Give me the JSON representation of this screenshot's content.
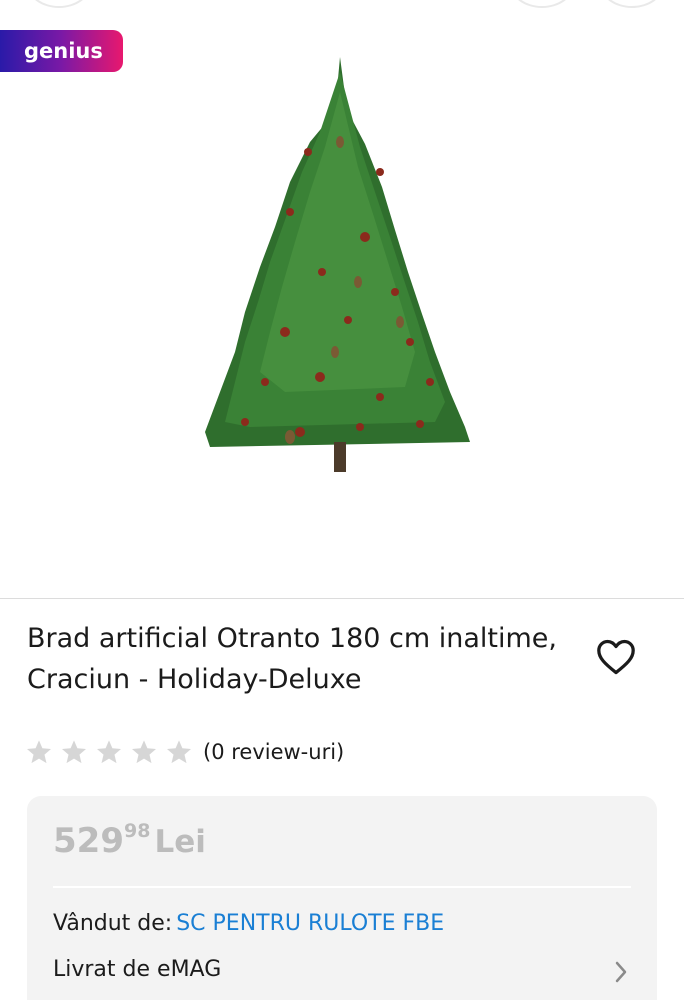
{
  "badge": {
    "label": "genius"
  },
  "product": {
    "title": "Brad artificial Otranto 180 cm inaltime, Craciun - Holiday-Deluxe",
    "image_subject": "christmas-tree"
  },
  "rating": {
    "stars_filled": 0,
    "stars_total": 5,
    "reviews_label": "(0 review-uri)"
  },
  "price": {
    "integer": "529",
    "decimals": "98",
    "currency": "Lei"
  },
  "seller": {
    "label": "Vândut de:",
    "name": "SC PENTRU RULOTE FBE"
  },
  "delivery": {
    "label": "Livrat de eMAG"
  },
  "colors": {
    "genius_start": "#2a1aa8",
    "genius_end": "#e8186e",
    "link": "#1a7fd4",
    "price_muted": "#bcbcbc",
    "star_empty": "#d6d6d6",
    "card_bg": "#f3f3f3"
  }
}
